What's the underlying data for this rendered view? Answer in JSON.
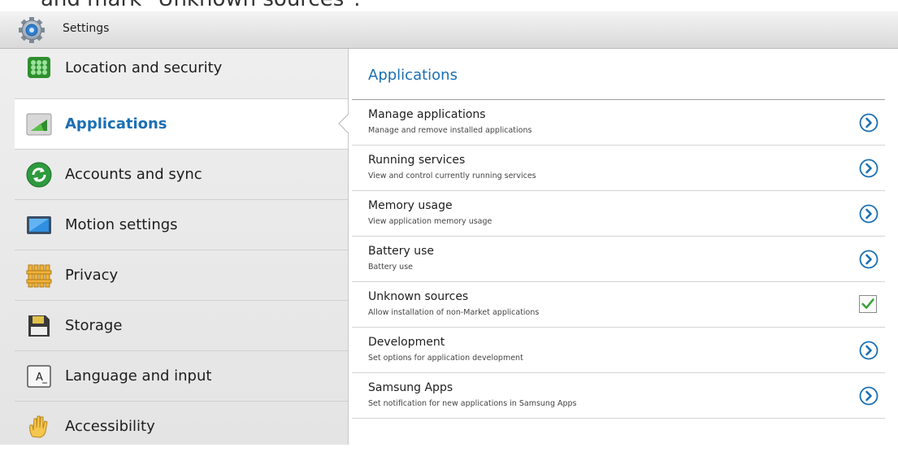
{
  "caption": "and mark \"Unknown sources\".",
  "app": {
    "title": "Settings"
  },
  "sidebar": {
    "items": [
      {
        "label": "Location and security",
        "icon": "grid-dots-icon",
        "active": false
      },
      {
        "label": "Applications",
        "icon": "applications-icon",
        "active": true
      },
      {
        "label": "Accounts and sync",
        "icon": "sync-icon",
        "active": false
      },
      {
        "label": "Motion settings",
        "icon": "tablet-screen-icon",
        "active": false
      },
      {
        "label": "Privacy",
        "icon": "fence-icon",
        "active": false
      },
      {
        "label": "Storage",
        "icon": "sd-card-icon",
        "active": false
      },
      {
        "label": "Language and input",
        "icon": "keyboard-letter-icon",
        "active": false
      },
      {
        "label": "Accessibility",
        "icon": "hand-icon",
        "active": false
      }
    ]
  },
  "main": {
    "section_title": "Applications",
    "options": [
      {
        "title": "Manage applications",
        "subtitle": "Manage and remove installed applications",
        "control": "chevron"
      },
      {
        "title": "Running services",
        "subtitle": "View and control currently running services",
        "control": "chevron"
      },
      {
        "title": "Memory usage",
        "subtitle": "View application memory usage",
        "control": "chevron"
      },
      {
        "title": "Battery use",
        "subtitle": "Battery use",
        "control": "chevron"
      },
      {
        "title": "Unknown sources",
        "subtitle": "Allow installation of non-Market applications",
        "control": "checkbox",
        "checked": true
      },
      {
        "title": "Development",
        "subtitle": "Set options for application development",
        "control": "chevron"
      },
      {
        "title": "Samsung Apps",
        "subtitle": "Set notification for new applications in Samsung Apps",
        "control": "chevron"
      }
    ]
  },
  "colors": {
    "accent": "#1b6fb3",
    "check": "#3aa33a"
  }
}
